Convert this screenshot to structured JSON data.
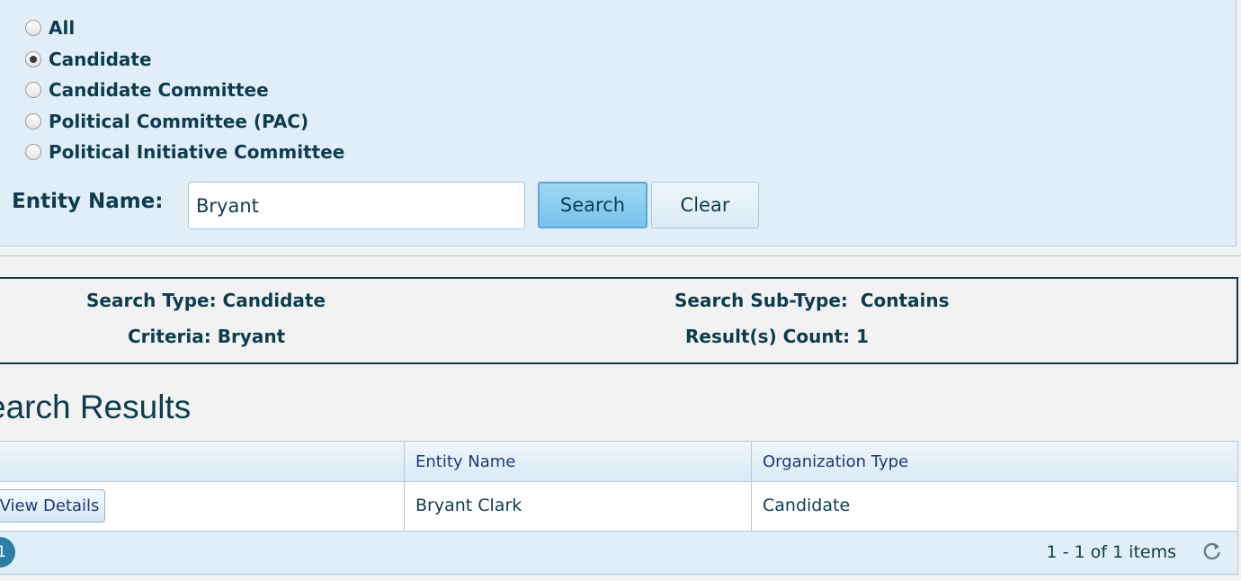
{
  "search_panel": {
    "radio_options": [
      {
        "label": "All",
        "checked": false
      },
      {
        "label": "Candidate",
        "checked": true
      },
      {
        "label": "Candidate Committee",
        "checked": false
      },
      {
        "label": "Political Committee (PAC)",
        "checked": false
      },
      {
        "label": "Political Initiative Committee",
        "checked": false
      }
    ],
    "entity_name_label": "Entity Name:",
    "entity_name_value": "Bryant",
    "search_button": "Search",
    "clear_button": "Clear"
  },
  "summary": {
    "search_type": "Search Type: Candidate",
    "search_sub_type": "Search Sub-Type:  Contains",
    "criteria": "Criteria: Bryant",
    "results_count": "Result(s) Count: 1"
  },
  "results": {
    "title": "earch Results",
    "columns": [
      "",
      "Entity Name",
      "Organization Type"
    ],
    "rows": [
      {
        "action": "View Details",
        "entity_name": "Bryant Clark",
        "organization_type": "Candidate"
      }
    ],
    "pager": {
      "current_page": "1",
      "info": "1 - 1 of 1 items"
    }
  },
  "icons": {
    "refresh": "refresh-icon"
  }
}
